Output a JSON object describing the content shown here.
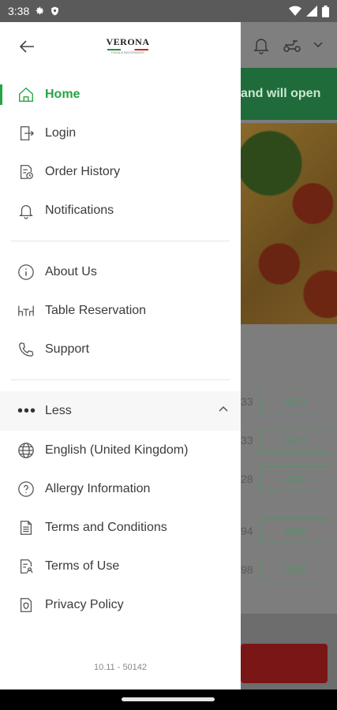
{
  "status_bar": {
    "time": "3:38"
  },
  "drawer": {
    "logo_text": "VERONA",
    "logo_sub": "PIZZA & RISTORANTE",
    "primary_items": [
      {
        "label": "Home",
        "icon": "home-icon",
        "active": true
      },
      {
        "label": "Login",
        "icon": "login-icon"
      },
      {
        "label": "Order History",
        "icon": "order-history-icon"
      },
      {
        "label": "Notifications",
        "icon": "bell-icon"
      }
    ],
    "secondary_items": [
      {
        "label": "About Us",
        "icon": "info-icon"
      },
      {
        "label": "Table Reservation",
        "icon": "table-icon"
      },
      {
        "label": "Support",
        "icon": "phone-icon"
      }
    ],
    "toggle_label": "Less",
    "more_items": [
      {
        "label": "English (United Kingdom)",
        "icon": "globe-icon"
      },
      {
        "label": "Allergy Information",
        "icon": "help-icon"
      },
      {
        "label": "Terms and Conditions",
        "icon": "document-icon"
      },
      {
        "label": "Terms of Use",
        "icon": "document-user-icon"
      },
      {
        "label": "Privacy Policy",
        "icon": "privacy-icon"
      }
    ],
    "version": "10.11 - 50142"
  },
  "background": {
    "banner_text": "and will open",
    "rows": [
      {
        "price": "33",
        "button": "ADD"
      },
      {
        "price": "33",
        "button": "ADD"
      },
      {
        "price": "28",
        "button": "ADD"
      },
      {
        "price": "94",
        "button": "ADD"
      },
      {
        "price": "98",
        "button": "ADD"
      }
    ]
  },
  "colors": {
    "accent": "#27a344",
    "banner": "#1f6b3a",
    "cta": "#7a1616"
  }
}
